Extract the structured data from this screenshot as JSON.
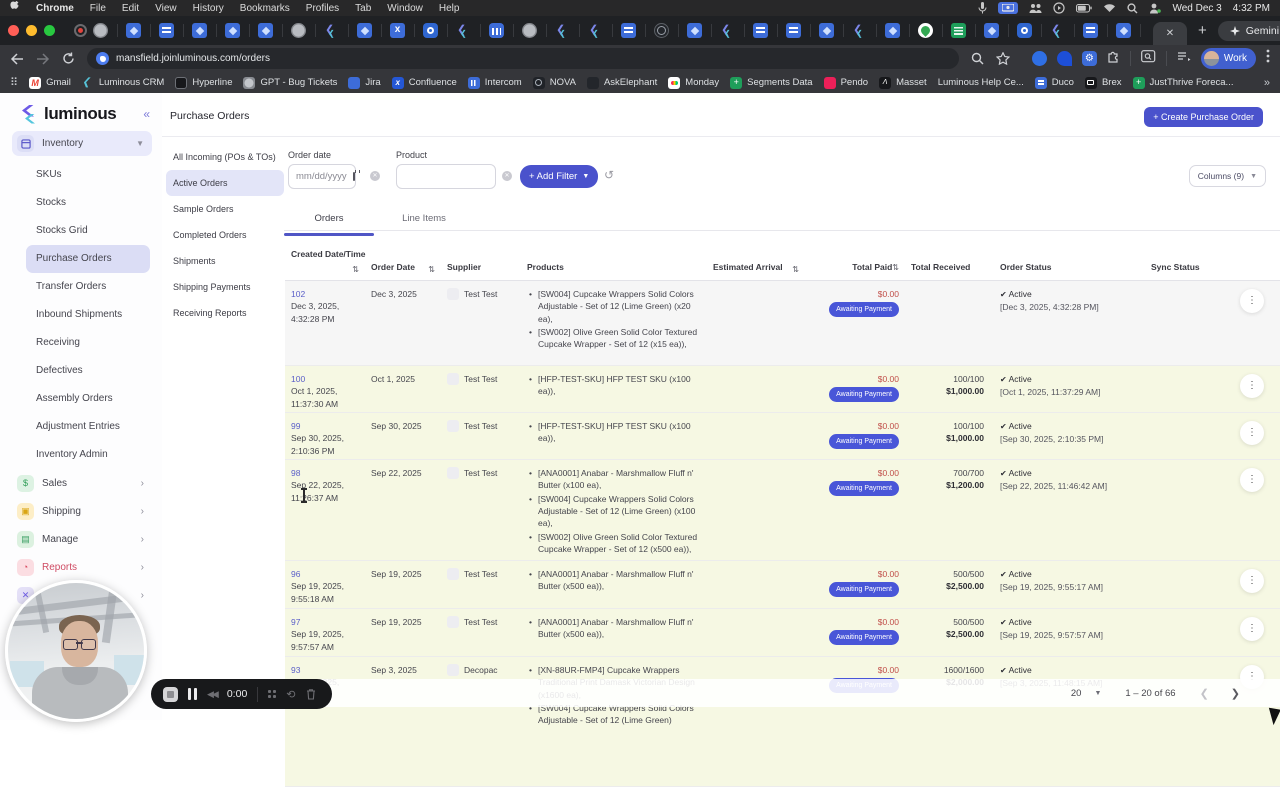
{
  "menubar": {
    "items": [
      "Chrome",
      "File",
      "Edit",
      "View",
      "History",
      "Bookmarks",
      "Profiles",
      "Tab",
      "Window",
      "Help"
    ],
    "date": "Wed Dec 3",
    "time": "4:32 PM"
  },
  "tabbar": {
    "pinned": [
      "gear",
      "jira",
      "doc",
      "jira",
      "jira",
      "jira",
      "gear",
      "lum",
      "jira",
      "conf",
      "o",
      "lum",
      "ic",
      "gear",
      "lum",
      "lum",
      "doc",
      "globe",
      "jira",
      "lum",
      "doc",
      "doc",
      "jira",
      "lum",
      "jira",
      "maps",
      "sheet",
      "jira",
      "o",
      "lum",
      "doc",
      "jira"
    ],
    "close_label": "✕",
    "new_tab": "+",
    "gemini_label": "Gemini"
  },
  "toolbar": {
    "url": "mansfield.joinluminous.com/orders",
    "profile_label": "Work"
  },
  "bookmarks": {
    "items": [
      {
        "label": "Gmail"
      },
      {
        "label": "Luminous CRM"
      },
      {
        "label": "Hyperline"
      },
      {
        "label": "GPT - Bug Tickets"
      },
      {
        "label": "Jira"
      },
      {
        "label": "Confluence"
      },
      {
        "label": "Intercom"
      },
      {
        "label": "NOVA"
      },
      {
        "label": "AskElephant"
      },
      {
        "label": "Monday"
      },
      {
        "label": "Segments Data"
      },
      {
        "label": "Pendo"
      },
      {
        "label": "Masset"
      },
      {
        "label": "Luminous Help Ce..."
      },
      {
        "label": "Duco"
      },
      {
        "label": "Brex"
      },
      {
        "label": "JustThrive Foreca..."
      }
    ],
    "overflow": "»"
  },
  "app": {
    "logo_text": "luminous",
    "sidebar": {
      "inventory_label": "Inventory",
      "sub_items": [
        "SKUs",
        "Stocks",
        "Stocks Grid",
        "Purchase Orders",
        "Transfer Orders",
        "Inbound Shipments",
        "Receiving",
        "Defectives",
        "Assembly Orders",
        "Adjustment Entries",
        "Inventory Admin"
      ],
      "groups": [
        "Sales",
        "Shipping",
        "Manage",
        "Reports"
      ]
    },
    "header": {
      "title": "Purchase Orders",
      "create_button": "+ Create Purchase Order"
    },
    "filter_nav": [
      "All Incoming (POs & TOs)",
      "Active Orders",
      "Sample Orders",
      "Completed Orders",
      "Shipments",
      "Shipping Payments",
      "Receiving Reports"
    ],
    "filters": {
      "order_date_label": "Order date",
      "date_placeholder": "mm/dd/yyyy",
      "product_label": "Product",
      "add_filter_label": "+ Add Filter",
      "columns_label": "Columns (9)"
    },
    "tabs": {
      "orders": "Orders",
      "line_items": "Line Items"
    },
    "table": {
      "columns": [
        "Created Date/Time",
        "Order Date",
        "Supplier",
        "Products",
        "Estimated Arrival",
        "Total Paid",
        "Total Received",
        "Order Status",
        "Sync Status"
      ],
      "rows": [
        {
          "id": "102",
          "created1": "Dec 3, 2025,",
          "created2": "4:32:28 PM",
          "order_date": "Dec 3, 2025",
          "supplier": "Test Test",
          "products": [
            "[SW004] Cupcake Wrappers Solid Colors Adjustable - Set of 12 (Lime Green) (x20 ea),",
            "[SW002] Olive Green Solid Color Textured Cupcake Wrapper - Set of 12 (x15 ea)),"
          ],
          "total_paid": "$0.00",
          "badge": "Awaiting Payment",
          "received_qty": "",
          "received_amt": "",
          "status_label": "Active",
          "status_date": "[Dec 3, 2025, 4:32:28 PM]"
        },
        {
          "id": "100",
          "created1": "Oct 1, 2025,",
          "created2": "11:37:30 AM",
          "order_date": "Oct 1, 2025",
          "supplier": "Test Test",
          "products": [
            "[HFP-TEST-SKU] HFP TEST SKU (x100 ea)),"
          ],
          "total_paid": "$0.00",
          "badge": "Awaiting Payment",
          "received_qty": "100/100",
          "received_amt": "$1,000.00",
          "status_label": "Active",
          "status_date": "[Oct 1, 2025, 11:37:29 AM]"
        },
        {
          "id": "99",
          "created1": "Sep 30, 2025,",
          "created2": "2:10:36 PM",
          "order_date": "Sep 30, 2025",
          "supplier": "Test Test",
          "products": [
            "[HFP-TEST-SKU] HFP TEST SKU (x100 ea)),"
          ],
          "total_paid": "$0.00",
          "badge": "Awaiting Payment",
          "received_qty": "100/100",
          "received_amt": "$1,000.00",
          "status_label": "Active",
          "status_date": "[Sep 30, 2025, 2:10:35 PM]"
        },
        {
          "id": "98",
          "created1": "Sep 22, 2025,",
          "created2": "11:26:37 AM",
          "order_date": "Sep 22, 2025",
          "supplier": "Test Test",
          "products": [
            "[ANA0001] Anabar - Marshmallow Fluff n' Butter (x100 ea),",
            "[SW004] Cupcake Wrappers Solid Colors Adjustable - Set of 12 (Lime Green) (x100 ea),",
            "[SW002] Olive Green Solid Color Textured Cupcake Wrapper - Set of 12 (x500 ea)),"
          ],
          "total_paid": "$0.00",
          "badge": "Awaiting Payment",
          "received_qty": "700/700",
          "received_amt": "$1,200.00",
          "status_label": "Active",
          "status_date": "[Sep 22, 2025, 11:46:42 AM]"
        },
        {
          "id": "96",
          "created1": "Sep 19, 2025,",
          "created2": "9:55:18 AM",
          "order_date": "Sep 19, 2025",
          "supplier": "Test Test",
          "products": [
            "[ANA0001] Anabar - Marshmallow Fluff n' Butter (x500 ea)),"
          ],
          "total_paid": "$0.00",
          "badge": "Awaiting Payment",
          "received_qty": "500/500",
          "received_amt": "$2,500.00",
          "status_label": "Active",
          "status_date": "[Sep 19, 2025, 9:55:17 AM]"
        },
        {
          "id": "97",
          "created1": "Sep 19, 2025,",
          "created2": "9:57:57 AM",
          "order_date": "Sep 19, 2025",
          "supplier": "Test Test",
          "products": [
            "[ANA0001] Anabar - Marshmallow Fluff n' Butter (x500 ea)),"
          ],
          "total_paid": "$0.00",
          "badge": "Awaiting Payment",
          "received_qty": "500/500",
          "received_amt": "$2,500.00",
          "status_label": "Active",
          "status_date": "[Sep 19, 2025, 9:57:57 AM]"
        },
        {
          "id": "93",
          "created1": "Sep 3, 2025,",
          "created2": "",
          "order_date": "Sep 3, 2025",
          "supplier": "Decopac",
          "products": [
            "[XN-88UR-FMP4] Cupcake Wrappers Traditional Print Damask Victorian Design (x1600 ea),",
            "[SW004] Cupcake Wrappers Solid Colors Adjustable - Set of 12 (Lime Green)"
          ],
          "total_paid": "$0.00",
          "badge": "Awaiting Payment",
          "received_qty": "1600/1600",
          "received_amt": "$2,000.00",
          "status_label": "Active",
          "status_date": "[Sep 3, 2025, 11:48:15 AM]"
        }
      ]
    },
    "pagination": {
      "page_size": "20",
      "range": "1 – 20 of 66"
    },
    "recorder": {
      "time": "0:00"
    }
  }
}
